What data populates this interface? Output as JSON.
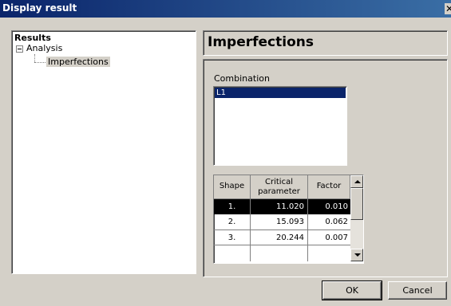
{
  "window": {
    "title": "Display result",
    "close_glyph": "✕"
  },
  "tree": {
    "root": "Results",
    "expander_icon": "minus-box-icon",
    "node_analysis": "Analysis",
    "node_imperfections": "Imperfections"
  },
  "header": {
    "title": "Imperfections"
  },
  "combination": {
    "label": "Combination",
    "items": [
      "L1"
    ],
    "selected": "L1"
  },
  "grid": {
    "columns": [
      "Shape",
      "Critical parameter",
      "Factor"
    ],
    "rows": [
      {
        "shape": "1.",
        "critical": "11.020",
        "factor": "0.010",
        "selected": true
      },
      {
        "shape": "2.",
        "critical": "15.093",
        "factor": "0.062",
        "selected": false
      },
      {
        "shape": "3.",
        "critical": "20.244",
        "factor": "0.007",
        "selected": false
      },
      {
        "shape": "",
        "critical": "",
        "factor": "",
        "selected": false
      }
    ],
    "scroll_up_icon": "arrow-up-icon",
    "scroll_down_icon": "arrow-down-icon"
  },
  "buttons": {
    "ok": "OK",
    "cancel": "Cancel"
  },
  "colors": {
    "titlebar": "#0a246a",
    "selection": "#0a246a",
    "grid_selection": "#000000",
    "face": "#d4d0c8"
  }
}
